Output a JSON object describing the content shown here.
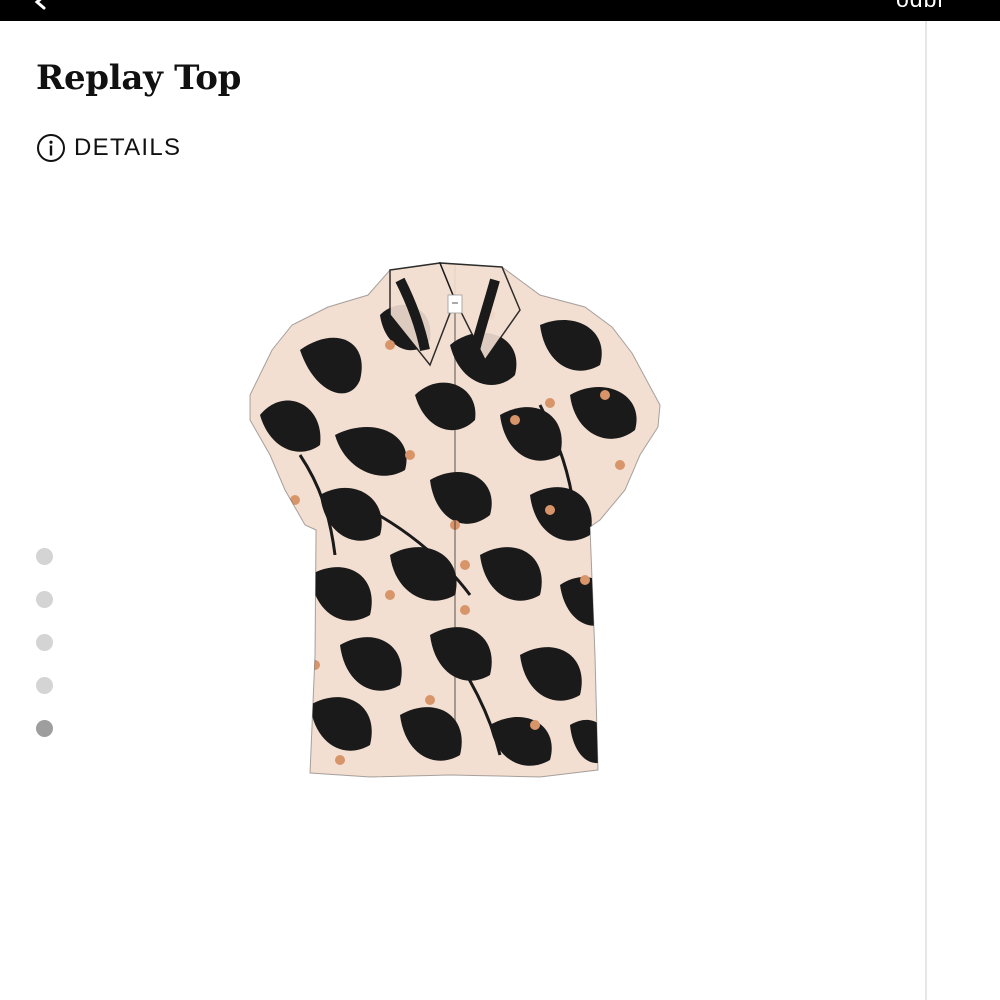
{
  "header": {
    "back_icon": "chevron-left-icon",
    "right_text": "odbr",
    "background_color": "#000000"
  },
  "product": {
    "title": "Replay Top",
    "details_label": "DETAILS",
    "details_icon": "info-circle-icon",
    "image_alt": "Short-sleeve collared blouse with black and peach floral print",
    "print_colors": {
      "base": "#f3dfd2",
      "leaf": "#1a1a1a",
      "flower_center": "#d9956a"
    }
  },
  "carousel": {
    "dots": [
      {
        "active": false
      },
      {
        "active": false
      },
      {
        "active": false
      },
      {
        "active": false
      },
      {
        "active": true
      }
    ],
    "active_color": "#9e9e9e",
    "inactive_color": "#d4d4d4"
  }
}
